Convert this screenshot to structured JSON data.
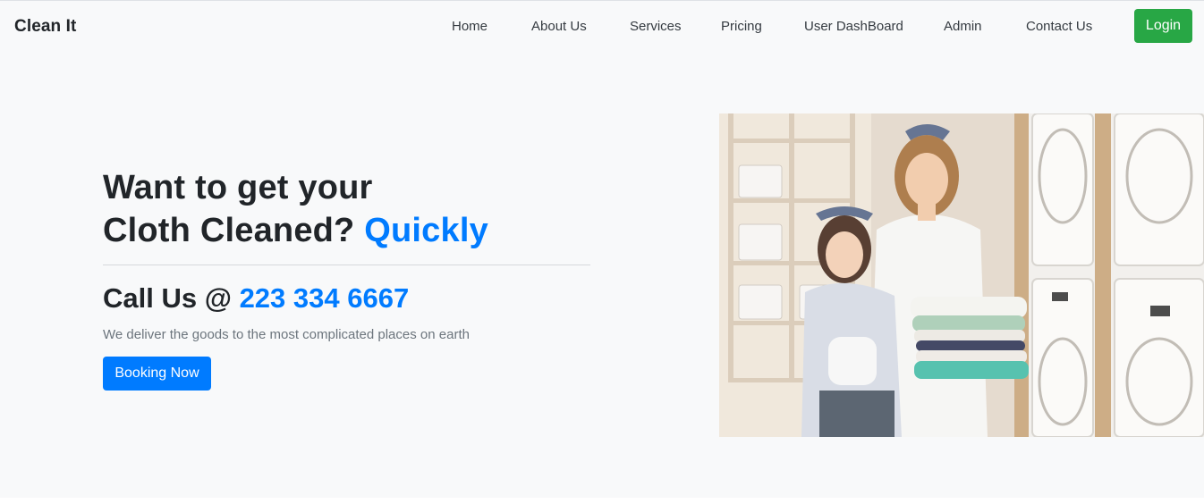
{
  "nav": {
    "brand": "Clean It",
    "links": [
      {
        "label": "Home"
      },
      {
        "label": "About Us"
      },
      {
        "label": "Services"
      },
      {
        "label": "Pricing"
      },
      {
        "label": "User DashBoard"
      },
      {
        "label": "Admin"
      },
      {
        "label": "Contact Us"
      }
    ],
    "login_label": "Login"
  },
  "hero": {
    "headline_line1": "Want to get your",
    "headline_line2": "Cloth Cleaned?",
    "headline_accent": "Quickly",
    "call_label": "Call Us @",
    "phone": "223 334 6667",
    "subtext": "We deliver the goods to the most complicated places on earth",
    "cta_label": "Booking Now"
  },
  "colors": {
    "primary": "#007bff",
    "success": "#28a745",
    "background": "#f8f9fa",
    "text": "#212529",
    "muted": "#6c757d"
  }
}
